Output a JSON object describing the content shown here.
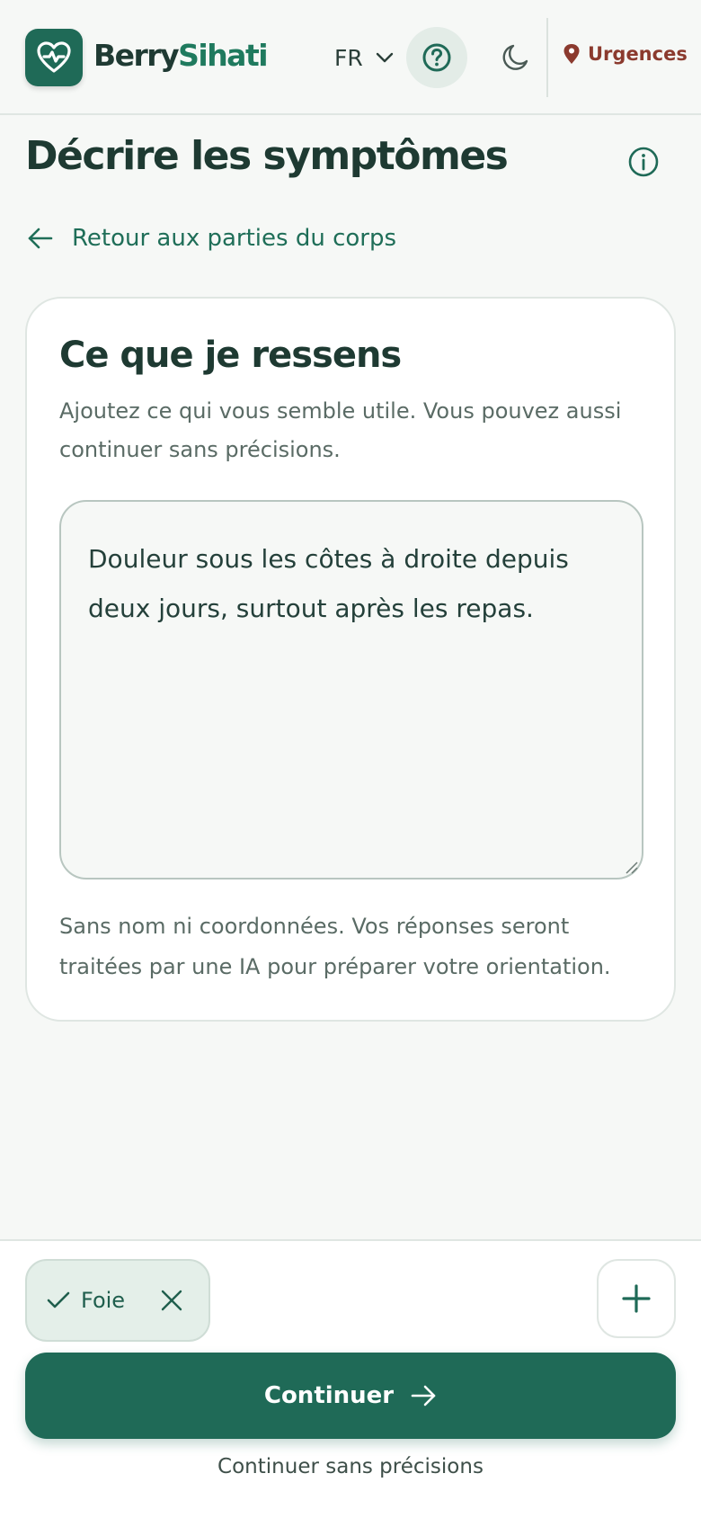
{
  "header": {
    "brand_part1": "Berry",
    "brand_part2": "Sihati",
    "language": "FR",
    "emergency_label": "Urgences"
  },
  "page": {
    "title": "Décrire les symptômes",
    "back_label": "Retour aux parties du corps"
  },
  "card": {
    "title": "Ce que je ressens",
    "description": "Ajoutez ce qui vous semble utile. Vous pouvez aussi continuer sans précisions.",
    "textarea_value": "Douleur sous les côtes à droite depuis deux jours, surtout après les repas.",
    "privacy_note": "Sans nom ni coordonnées. Vos réponses seront traitées par une IA pour préparer votre orientation."
  },
  "bottom": {
    "selected_chip": "Foie",
    "continue_label": "Continuer",
    "skip_label": "Continuer sans précisions"
  },
  "colors": {
    "primary": "#1f6a57",
    "emergency": "#8b3a2e",
    "background": "#f6f8f6"
  },
  "icons": [
    "heart-pulse-icon",
    "chevron-down-icon",
    "help-circle-icon",
    "moon-icon",
    "location-pin-icon",
    "info-icon",
    "arrow-left-icon",
    "check-icon",
    "close-icon",
    "plus-icon",
    "arrow-right-icon"
  ]
}
